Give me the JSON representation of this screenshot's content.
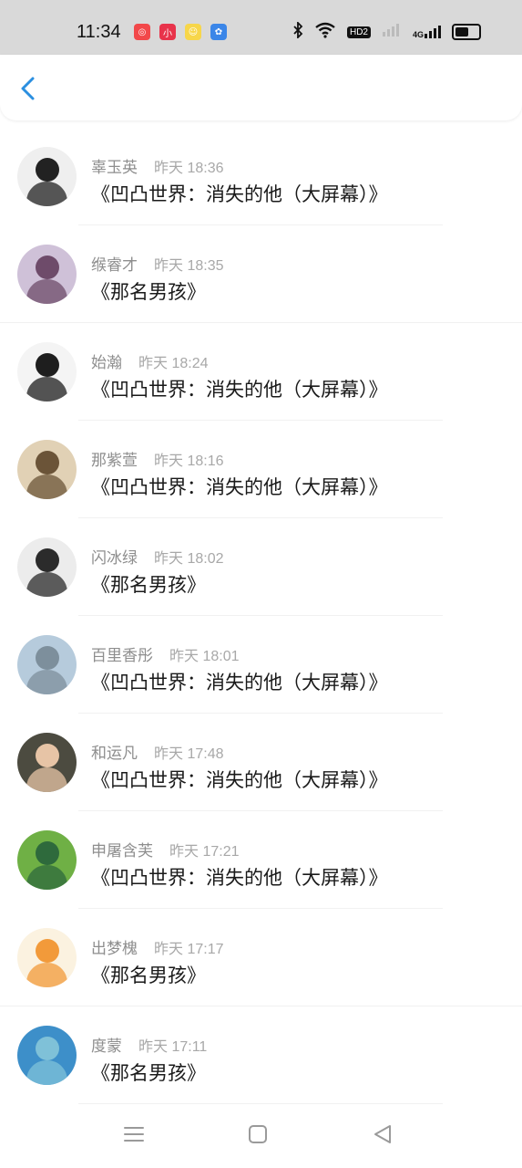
{
  "status_bar": {
    "time": "11:34",
    "app_icons": [
      {
        "name": "app-icon-red",
        "color": "#f2484a",
        "glyph": "◎"
      },
      {
        "name": "app-icon-pink",
        "color": "#e8334b",
        "glyph": "小"
      },
      {
        "name": "app-icon-yellow",
        "color": "#f7d64a",
        "glyph": "☺"
      },
      {
        "name": "app-icon-blue",
        "color": "#3b86e8",
        "glyph": "✿"
      }
    ],
    "network_badge": "HD2",
    "network_type": "4G"
  },
  "list": {
    "items": [
      {
        "name": "辜玉英",
        "time": "昨天 18:36",
        "title": "《凹凸世界：消失的他（大屏幕）》",
        "avatar_bg": "#efefef",
        "avatar_fg": "#222222"
      },
      {
        "name": "缑睿才",
        "time": "昨天 18:35",
        "title": "《那名男孩》",
        "avatar_bg": "#cfc1d8",
        "avatar_fg": "#6e4b6a"
      },
      {
        "name": "始瀚",
        "time": "昨天 18:24",
        "title": "《凹凸世界：消失的他（大屏幕）》",
        "avatar_bg": "#f4f4f4",
        "avatar_fg": "#1e1e1e"
      },
      {
        "name": "那紫萱",
        "time": "昨天 18:16",
        "title": "《凹凸世界：消失的他（大屏幕）》",
        "avatar_bg": "#e1d1b5",
        "avatar_fg": "#6b5438"
      },
      {
        "name": "闪冰绿",
        "time": "昨天 18:02",
        "title": "《那名男孩》",
        "avatar_bg": "#ececec",
        "avatar_fg": "#2b2b2b"
      },
      {
        "name": "百里香彤",
        "time": "昨天 18:01",
        "title": "《凹凸世界：消失的他（大屏幕）》",
        "avatar_bg": "#b6cbdc",
        "avatar_fg": "#7d8f9c"
      },
      {
        "name": "和运凡",
        "time": "昨天 17:48",
        "title": "《凹凸世界：消失的他（大屏幕）》",
        "avatar_bg": "#4c4b40",
        "avatar_fg": "#e7c4a6"
      },
      {
        "name": "申屠含芙",
        "time": "昨天 17:21",
        "title": "《凹凸世界：消失的他（大屏幕）》",
        "avatar_bg": "#6fb045",
        "avatar_fg": "#2e6a3c"
      },
      {
        "name": "出梦槐",
        "time": "昨天 17:17",
        "title": "《那名男孩》",
        "avatar_bg": "#fbf2e0",
        "avatar_fg": "#f29a3a"
      },
      {
        "name": "度蒙",
        "time": "昨天 17:11",
        "title": "《那名男孩》",
        "avatar_bg": "#3d8fc9",
        "avatar_fg": "#7fc1d8"
      }
    ]
  },
  "colors": {
    "accent": "#2b8fe0",
    "name_text": "#8e8e8e",
    "time_text": "#a8a8a8",
    "title_text": "#1a1a1a"
  }
}
